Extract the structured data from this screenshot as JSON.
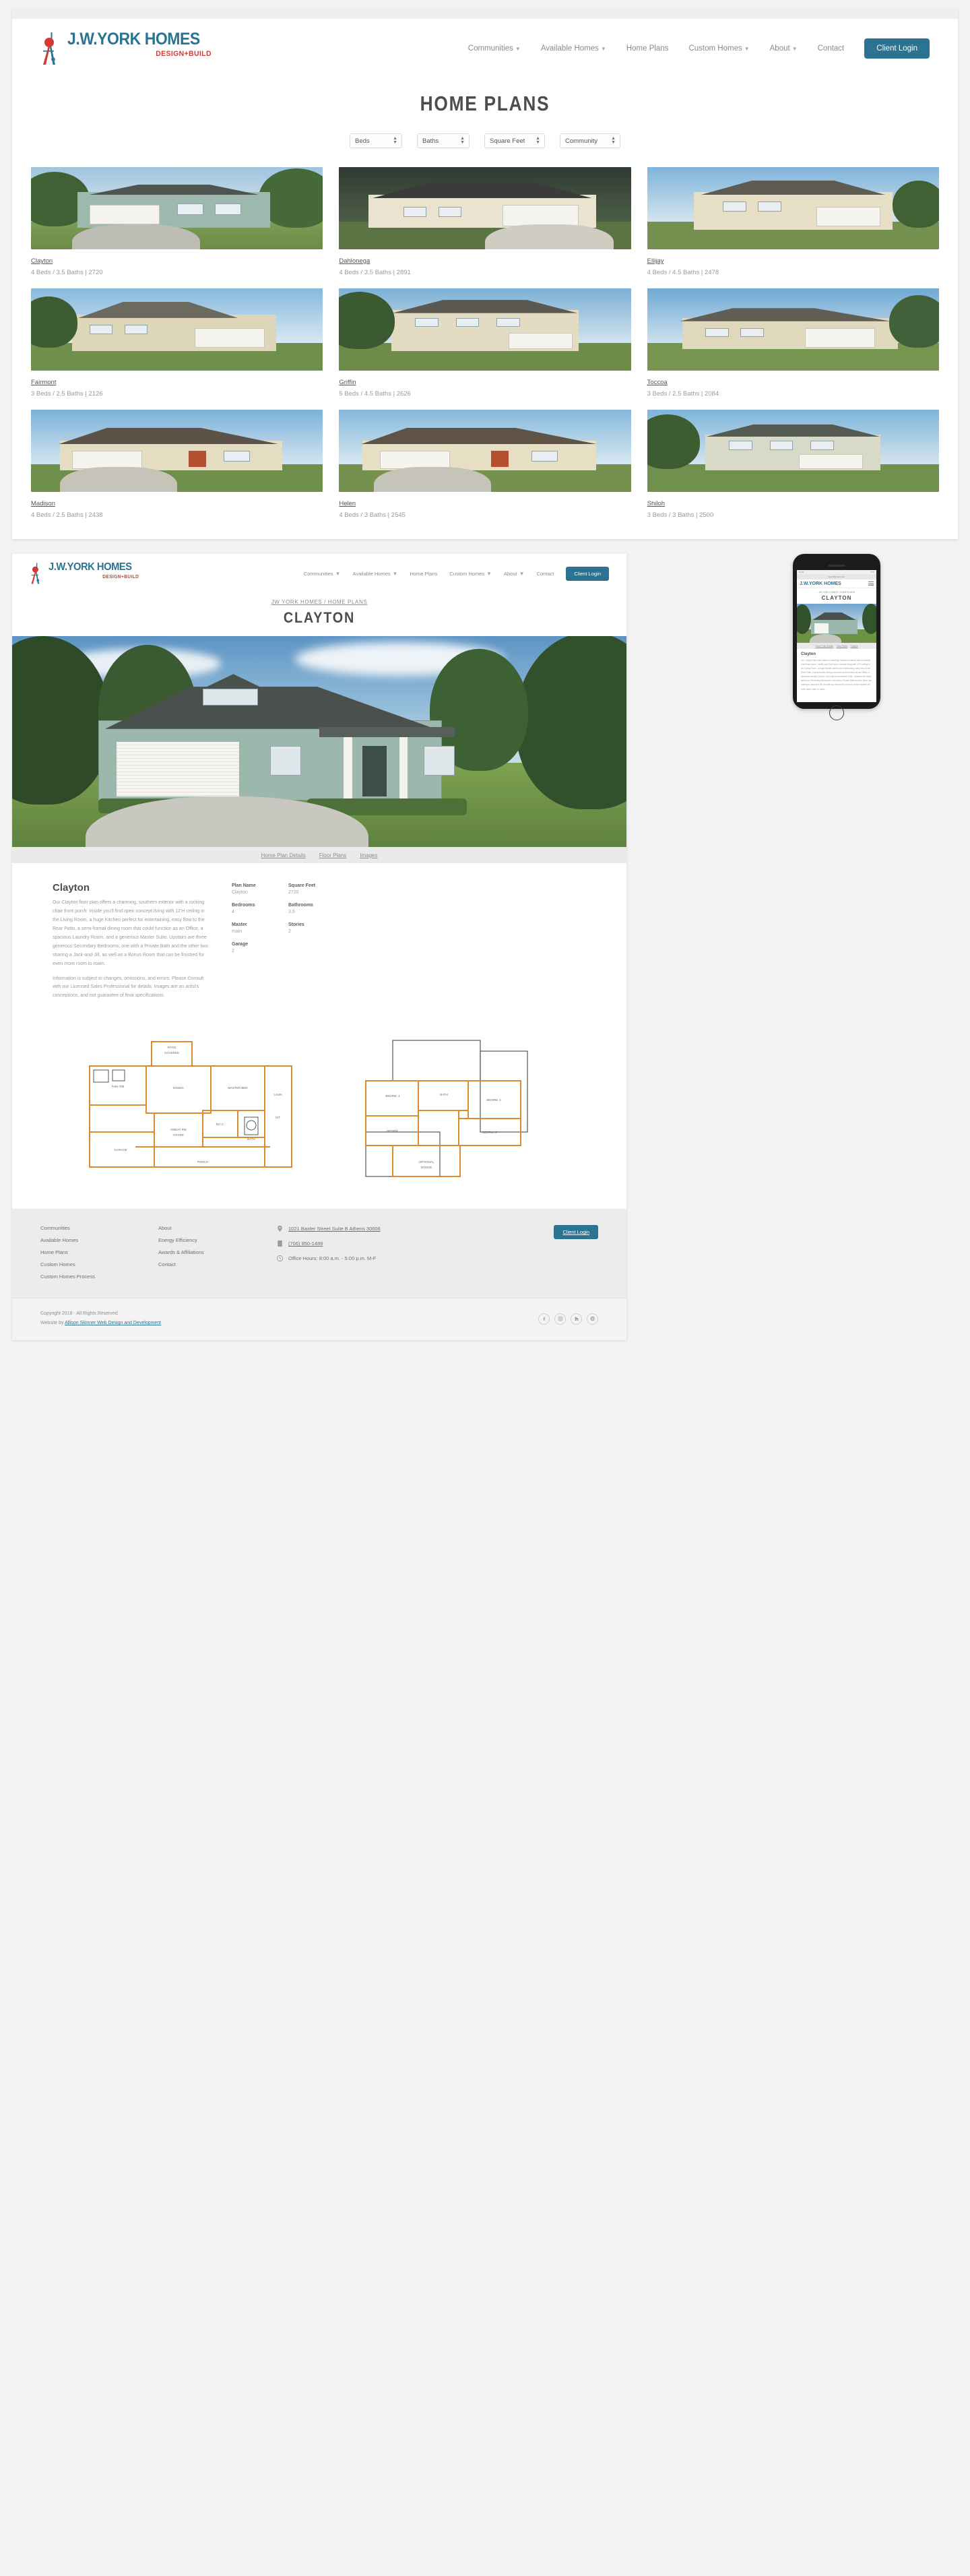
{
  "brand": {
    "name_line": "J.W.YORK HOMES",
    "tagline": "DESIGN+BUILD"
  },
  "nav": {
    "items": [
      {
        "label": "Communities",
        "has_dropdown": true
      },
      {
        "label": "Available Homes",
        "has_dropdown": true
      },
      {
        "label": "Home Plans",
        "has_dropdown": false
      },
      {
        "label": "Custom Homes",
        "has_dropdown": true
      },
      {
        "label": "About",
        "has_dropdown": true
      },
      {
        "label": "Contact",
        "has_dropdown": false
      }
    ],
    "client_login": "Client Login",
    "caret_icon": "chevron-down-icon"
  },
  "listing": {
    "title": "HOME PLANS",
    "filters": [
      {
        "name": "beds",
        "label": "Beds"
      },
      {
        "name": "baths",
        "label": "Baths"
      },
      {
        "name": "square-feet",
        "label": "Square Feet"
      },
      {
        "name": "community",
        "label": "Community"
      }
    ],
    "plans": [
      {
        "name": "Clayton",
        "spec": "4 Beds / 3.5 Baths | 2720"
      },
      {
        "name": "Dahlonega",
        "spec": "4 Beds / 3.5 Baths | 2891"
      },
      {
        "name": "Ellijay",
        "spec": "4 Beds / 4.5 Baths | 2478"
      },
      {
        "name": "Fairmont",
        "spec": "3 Beds / 2.5 Baths | 2126"
      },
      {
        "name": "Griffin",
        "spec": "5 Beds / 4.5 Baths | 2626"
      },
      {
        "name": "Toccoa",
        "spec": "3 Beds / 2.5 Baths | 2084"
      },
      {
        "name": "Madison",
        "spec": "4 Beds / 2.5 Baths | 2438"
      },
      {
        "name": "Helen",
        "spec": "4 Beds / 3 Baths | 2545"
      },
      {
        "name": "Shiloh",
        "spec": "3 Beds / 3 Baths | 2500"
      }
    ]
  },
  "detail": {
    "breadcrumb_home": "JW YORK HOMES",
    "breadcrumb_sep": " / ",
    "breadcrumb_current": "HOME PLANS",
    "title": "CLAYTON",
    "tabs": [
      {
        "label": "Home Plan Details"
      },
      {
        "label": "Floor Plans"
      },
      {
        "label": "Images"
      }
    ],
    "heading": "Clayton",
    "paragraph1": "Our Clayton floor plan offers a charming, southern exterior with a rocking chair front porch. Inside you'll find open concept living with 12'H ceiling in the Living Room, a huge Kitchen perfect for entertaining, easy flow to the Rear Patio, a semi-formal dining room that could function as an Office, a spacious Laundry Room, and a generous Master Suite. Upstairs are three generous Secondary Bedrooms, one with a Private Bath and the other two sharing a Jack-and-Jill, as well as a Bonus Room that can be finished for even more room to roam.",
    "paragraph2": "Information is subject to changes, omissions, and errors. Please Consult with our Licensed Sales Professional for details. Images are an artist's conceptions, and not guarantee of final specifications.",
    "specs": [
      {
        "label": "Plan Name",
        "value": "Clayton"
      },
      {
        "label": "Square Feet",
        "value": "2720"
      },
      {
        "label": "Bedrooms",
        "value": "4"
      },
      {
        "label": "Bathrooms",
        "value": "3.5"
      },
      {
        "label": "Master",
        "value": "main"
      },
      {
        "label": "Stories",
        "value": "2"
      },
      {
        "label": "Garage",
        "value": "2"
      }
    ],
    "floorplan_labels": {
      "first": [
        "PATIO",
        "COVERED",
        "FAM. RM",
        "DINING",
        "MASTER BED",
        "W.I.C.",
        "GREAT RM",
        "FOYER",
        "W.C.",
        "KIT.",
        "GARAGE",
        "PORCH",
        "BATH",
        "LAUN."
      ],
      "second": [
        "BEDRM. 4",
        "BEDRM. 3",
        "BEDRM. 2",
        "OPTIONAL BONUS",
        "BATH",
        "ATTIC"
      ]
    }
  },
  "phone": {
    "status_left": "11:30",
    "status_right": "77%",
    "url": "jwyorkhomes.com",
    "menu_icon": "hamburger-icon"
  },
  "footer": {
    "col1": [
      "Communities",
      "Available Homes",
      "Home Plans",
      "Custom Homes",
      "Custom Homes Process"
    ],
    "col2": [
      "About",
      "Energy Efficiency",
      "Awards & Affiliations",
      "Contact"
    ],
    "contact": [
      {
        "icon": "map-pin-icon",
        "text": "1021 Baxter Street Suite B Athens 30606",
        "underline": true
      },
      {
        "icon": "phone-icon",
        "text": "(706) 850-1489",
        "underline": true
      },
      {
        "icon": "clock-icon",
        "text": "Office Hours: 8:00 a.m. - 5:00 p.m. M-F",
        "underline": false
      }
    ],
    "client_login": "Client Login",
    "copyright": "Copyright 2018 - All Rights Reserved",
    "credit_prefix": "Website by ",
    "credit_link": "Allison Skinner Web Design and Development",
    "socials": [
      "facebook-icon",
      "instagram-icon",
      "houzz-icon",
      "pinterest-icon"
    ]
  },
  "colors": {
    "brand_blue": "#2b7390",
    "brand_red": "#d63a34",
    "text_gray": "#8a8a8a"
  }
}
